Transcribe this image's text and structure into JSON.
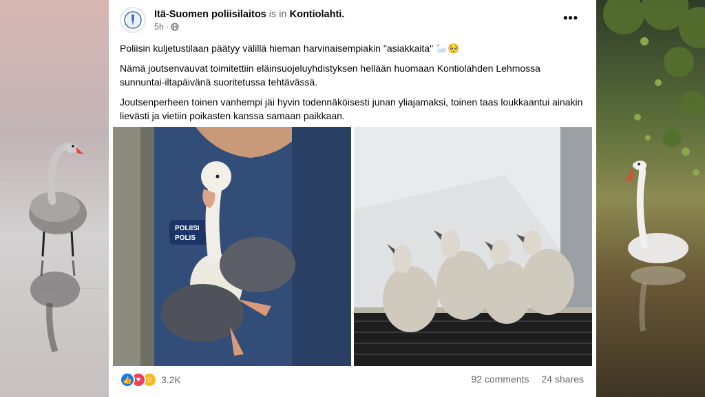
{
  "post": {
    "author": "Itä-Suomen poliisilaitos",
    "is_in": "is in",
    "location": "Kontiolahti.",
    "time": "5h",
    "paragraphs": [
      "Poliisin kuljetustilaan päätyy välillä hieman harvinaisempiakin \"asiakkaita\" 🦢🥺",
      "Nämä joutsenvauvat toimitettiin eläinsuojeluyhdistyksen hellään huomaan Kontiolahden Lehmossa sunnuntai-iltapäivänä suoritetussa tehtävässä.",
      "Joutsenperheen toinen vanhempi jäi hyvin todennäköisesti junan yliajamaksi, toinen taas loukkaantui ainakin lievästi ja vietiin poikasten kanssa samaan paikkaan."
    ],
    "patch_text": "POLIISI\nPOLIS"
  },
  "footer": {
    "reaction_count": "3.2K",
    "comments": "92 comments",
    "shares": "24 shares"
  },
  "icons": {
    "avatar": "police-crest-icon",
    "privacy": "globe-icon",
    "more": "ellipsis-icon",
    "reactions": [
      "like-icon",
      "love-icon",
      "care-icon"
    ]
  },
  "colors": {
    "like": "#1877f2",
    "love": "#f33e58",
    "care": "#f7b928",
    "uniform": "#2f4a78"
  }
}
